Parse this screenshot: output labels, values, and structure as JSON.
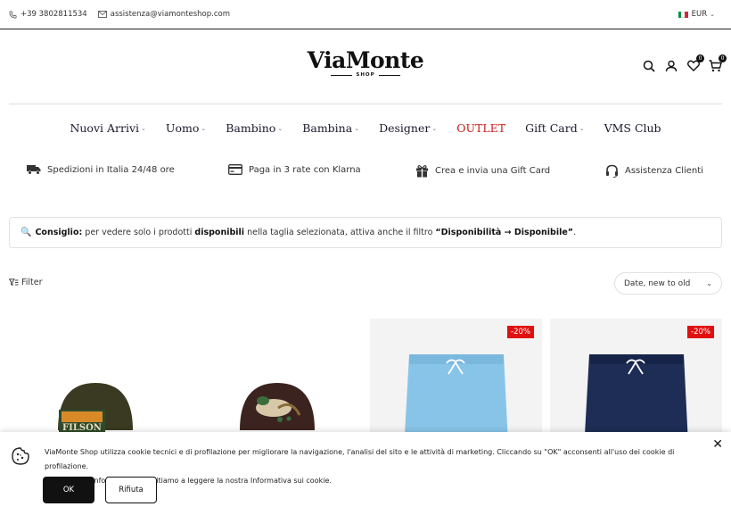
{
  "topbar": {
    "phone": "+39 3802811534",
    "email": "assistenza@viamonteshop.com",
    "currency": "EUR",
    "flag_colors": [
      "#009246",
      "#ffffff",
      "#ce2b37"
    ]
  },
  "header": {
    "logo_name": "ViaMonte",
    "logo_sub": "SHOP",
    "icons": [
      "search-icon",
      "user-icon",
      "heart-icon",
      "cart-icon"
    ],
    "wishlist_count": "0",
    "cart_count": "0"
  },
  "nav": {
    "items": [
      {
        "label": "Nuovi Arrivi",
        "has_dropdown": true
      },
      {
        "label": "Uomo",
        "has_dropdown": true
      },
      {
        "label": "Bambino",
        "has_dropdown": true
      },
      {
        "label": "Bambina",
        "has_dropdown": true
      },
      {
        "label": "Designer",
        "has_dropdown": true
      },
      {
        "label": "OUTLET",
        "has_dropdown": false,
        "color": "#d11a1a"
      },
      {
        "label": "Gift Card",
        "has_dropdown": true
      },
      {
        "label": "VMS Club",
        "has_dropdown": false
      }
    ]
  },
  "features": [
    {
      "icon": "truck-icon",
      "label": "Spedizioni in Italia 24/48 ore"
    },
    {
      "icon": "credit-card-icon",
      "label": "Paga in 3 rate con Klarna"
    },
    {
      "icon": "gift-icon",
      "label": "Crea e invia una Gift Card"
    },
    {
      "icon": "headset-icon",
      "label": "Assistenza Clienti"
    }
  ],
  "tip": {
    "icon": "magnifier-icon",
    "label": "Consiglio:",
    "text1": "per vedere solo i prodotti",
    "bold1": "disponibili",
    "text2": "nella taglia selezionata, attiva anche il filtro",
    "bold2": "“Disponibilità → Disponibile”",
    "end": "."
  },
  "toolbar": {
    "filter_label": "Filter",
    "sort_value": "Date, new to old"
  },
  "products": [
    {
      "name": "filson-cap",
      "color": "#3a3a22",
      "discount": ""
    },
    {
      "name": "duck-cap",
      "color": "#3b2320",
      "discount": ""
    },
    {
      "name": "light-blue-swim-shorts",
      "color": "#88c4e8",
      "discount": "-20%"
    },
    {
      "name": "navy-swim-shorts",
      "color": "#1d2d55",
      "discount": "-20%"
    }
  ],
  "cookie": {
    "line1": "ViaMonte Shop utilizza cookie tecnici e di profilazione per migliorare la navigazione, l'analisi del sito e le attività di marketing. Cliccando su \"OK\" acconsenti all'uso dei cookie di profilazione.",
    "line2": "Per maggiori informazioni ti invitiamo a leggere la nostra Informativa sui cookie.",
    "ok_label": "OK",
    "reject_label": "Rifiuta"
  }
}
